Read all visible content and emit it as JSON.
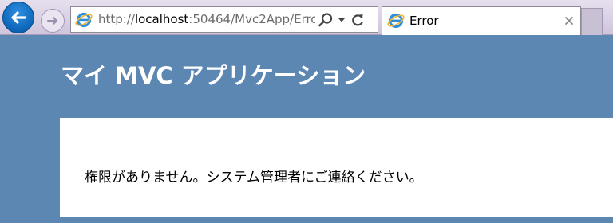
{
  "browser": {
    "address": {
      "protocol": "http://",
      "host": "localhost",
      "rest": ":50464/Mvc2App/Erro"
    },
    "tab": {
      "title": "Error"
    },
    "icons": {
      "back": "back-arrow-icon",
      "forward": "forward-arrow-icon",
      "favicon": "ie-logo-icon",
      "search": "search-icon",
      "dropdown": "chevron-down-icon",
      "refresh": "refresh-icon",
      "close": "close-icon"
    }
  },
  "page": {
    "title": "マイ MVC アプリケーション",
    "message": "権限がありません。システム管理者にご連絡ください。"
  },
  "colors": {
    "page_background": "#5c87b2",
    "content_background": "#ffffff",
    "back_button": "#1372c8"
  }
}
